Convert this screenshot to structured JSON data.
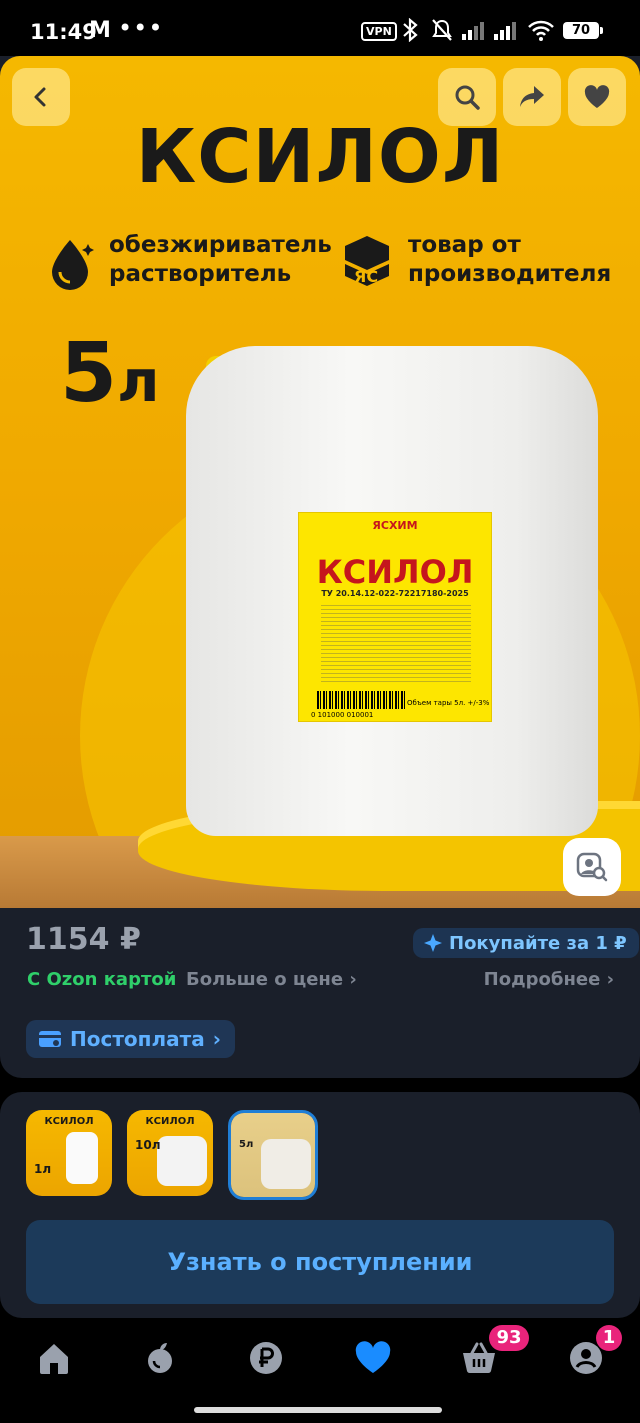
{
  "status_bar": {
    "time": "11:49",
    "mail_icon": "M",
    "dots": "•••",
    "vpn": "VPN",
    "battery": "70"
  },
  "hero": {
    "title": "КСИЛОЛ",
    "feature_left": [
      "обезжириватель",
      "растворитель"
    ],
    "feature_right": [
      "товар от",
      "производителя"
    ],
    "volume_number": "5",
    "volume_unit": "л",
    "label_brand": "ЯСХИМ",
    "label_name": "КСИЛОЛ",
    "label_tu": "ТУ 20.14.12-022-72217180-2025",
    "barcode_number": "0   101000   010001",
    "label_volume": "Объем тары 5л. +/-3%"
  },
  "price": {
    "value": "1154 ₽",
    "promo": "Покупайте за 1 ₽",
    "ozon_card": "С Ozon картой",
    "more_about_price": "Больше о цене",
    "details": "Подробнее"
  },
  "postpay": {
    "label": "Постоплата"
  },
  "thumbnails": [
    {
      "label": "КСИЛОЛ",
      "volume": "1л"
    },
    {
      "label": "КСИЛОЛ",
      "volume": "10л"
    },
    {
      "label": "",
      "volume": "5л"
    }
  ],
  "notify": {
    "label": "Узнать о поступлении"
  },
  "nav": {
    "cart_badge": "93",
    "profile_badge": "1"
  },
  "colors": {
    "accent_blue": "#5bb0ff",
    "green": "#2fcf6a",
    "badge_pink": "#e9247b",
    "hero_yellow": "#f5b800"
  }
}
